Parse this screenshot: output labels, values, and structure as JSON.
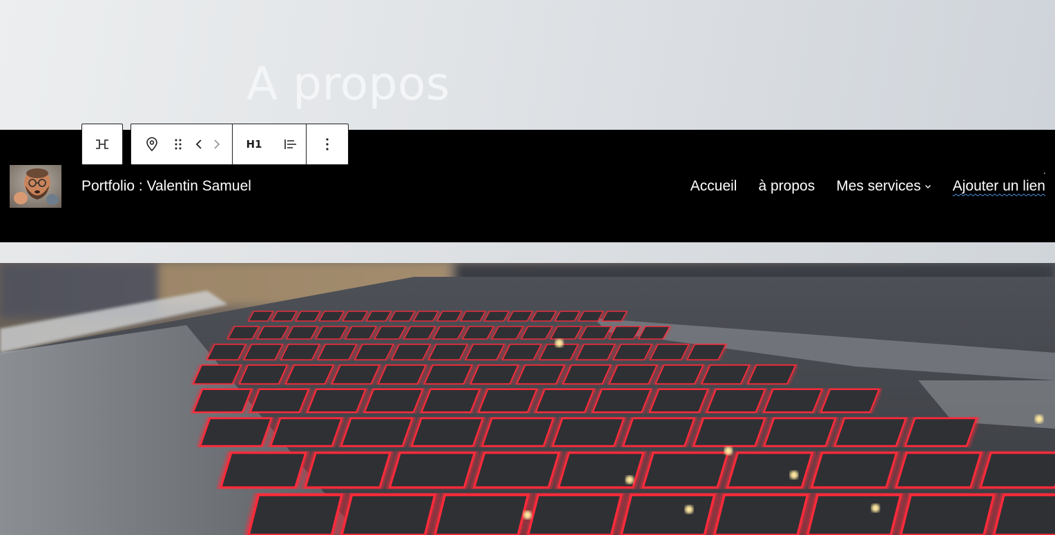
{
  "hero": {
    "title": "A propos"
  },
  "header": {
    "site_title": "Portfolio : Valentin Samuel",
    "nav": {
      "items": [
        {
          "label": "Accueil"
        },
        {
          "label": "à propos"
        },
        {
          "label": "Mes services",
          "has_submenu": true
        },
        {
          "label": "Ajouter un lien"
        }
      ]
    }
  },
  "toolbar": {
    "groups": [
      {
        "buttons": [
          {
            "icon": "transform-icon"
          }
        ]
      },
      {
        "buttons": [
          {
            "icon": "location-pin-icon"
          },
          {
            "icon": "drag-handle-icon"
          },
          {
            "icon": "chevron-left-icon"
          },
          {
            "icon": "chevron-right-icon"
          }
        ]
      },
      {
        "buttons": [
          {
            "label": "H1"
          },
          {
            "icon": "align-left-icon"
          }
        ]
      },
      {
        "buttons": [
          {
            "icon": "more-vertical-icon"
          }
        ]
      }
    ]
  },
  "colors": {
    "header_bg": "#000000",
    "title_color": "#f4f5f6",
    "key_glow": "#ff2a3a",
    "toolbar_border": "#1e1e1e"
  }
}
